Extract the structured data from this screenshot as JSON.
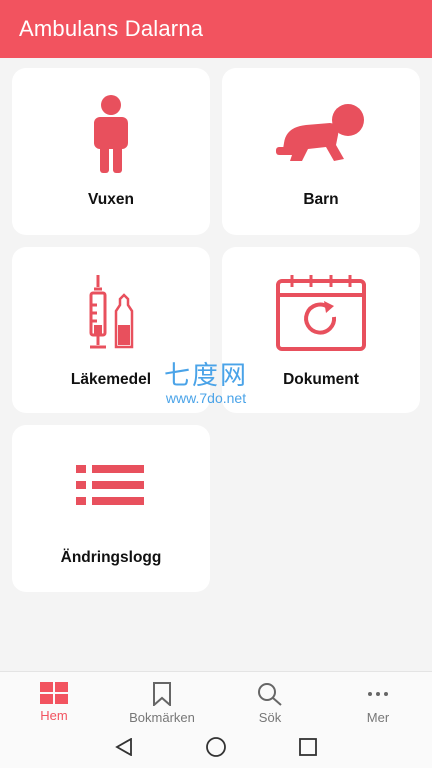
{
  "app": {
    "title": "Ambulans Dalarna"
  },
  "tiles": [
    {
      "label": "Vuxen",
      "icon": "adult-person-icon"
    },
    {
      "label": "Barn",
      "icon": "crawling-baby-icon"
    },
    {
      "label": "Läkemedel",
      "icon": "syringe-ampoule-icon"
    },
    {
      "label": "Dokument",
      "icon": "calendar-refresh-icon"
    },
    {
      "label": "Ändringslogg",
      "icon": "list-icon"
    }
  ],
  "watermark": {
    "logo": "七度网",
    "url": "www.7do.net"
  },
  "bottom_nav": [
    {
      "label": "Hem",
      "icon": "grid-home-icon",
      "active": true
    },
    {
      "label": "Bokmärken",
      "icon": "bookmark-icon",
      "active": false
    },
    {
      "label": "Sök",
      "icon": "search-icon",
      "active": false
    },
    {
      "label": "Mer",
      "icon": "more-dots-icon",
      "active": false
    }
  ],
  "colors": {
    "accent": "#f2535f",
    "icon": "#e8505d",
    "background": "#f4f4f4",
    "inactive": "#777777"
  }
}
